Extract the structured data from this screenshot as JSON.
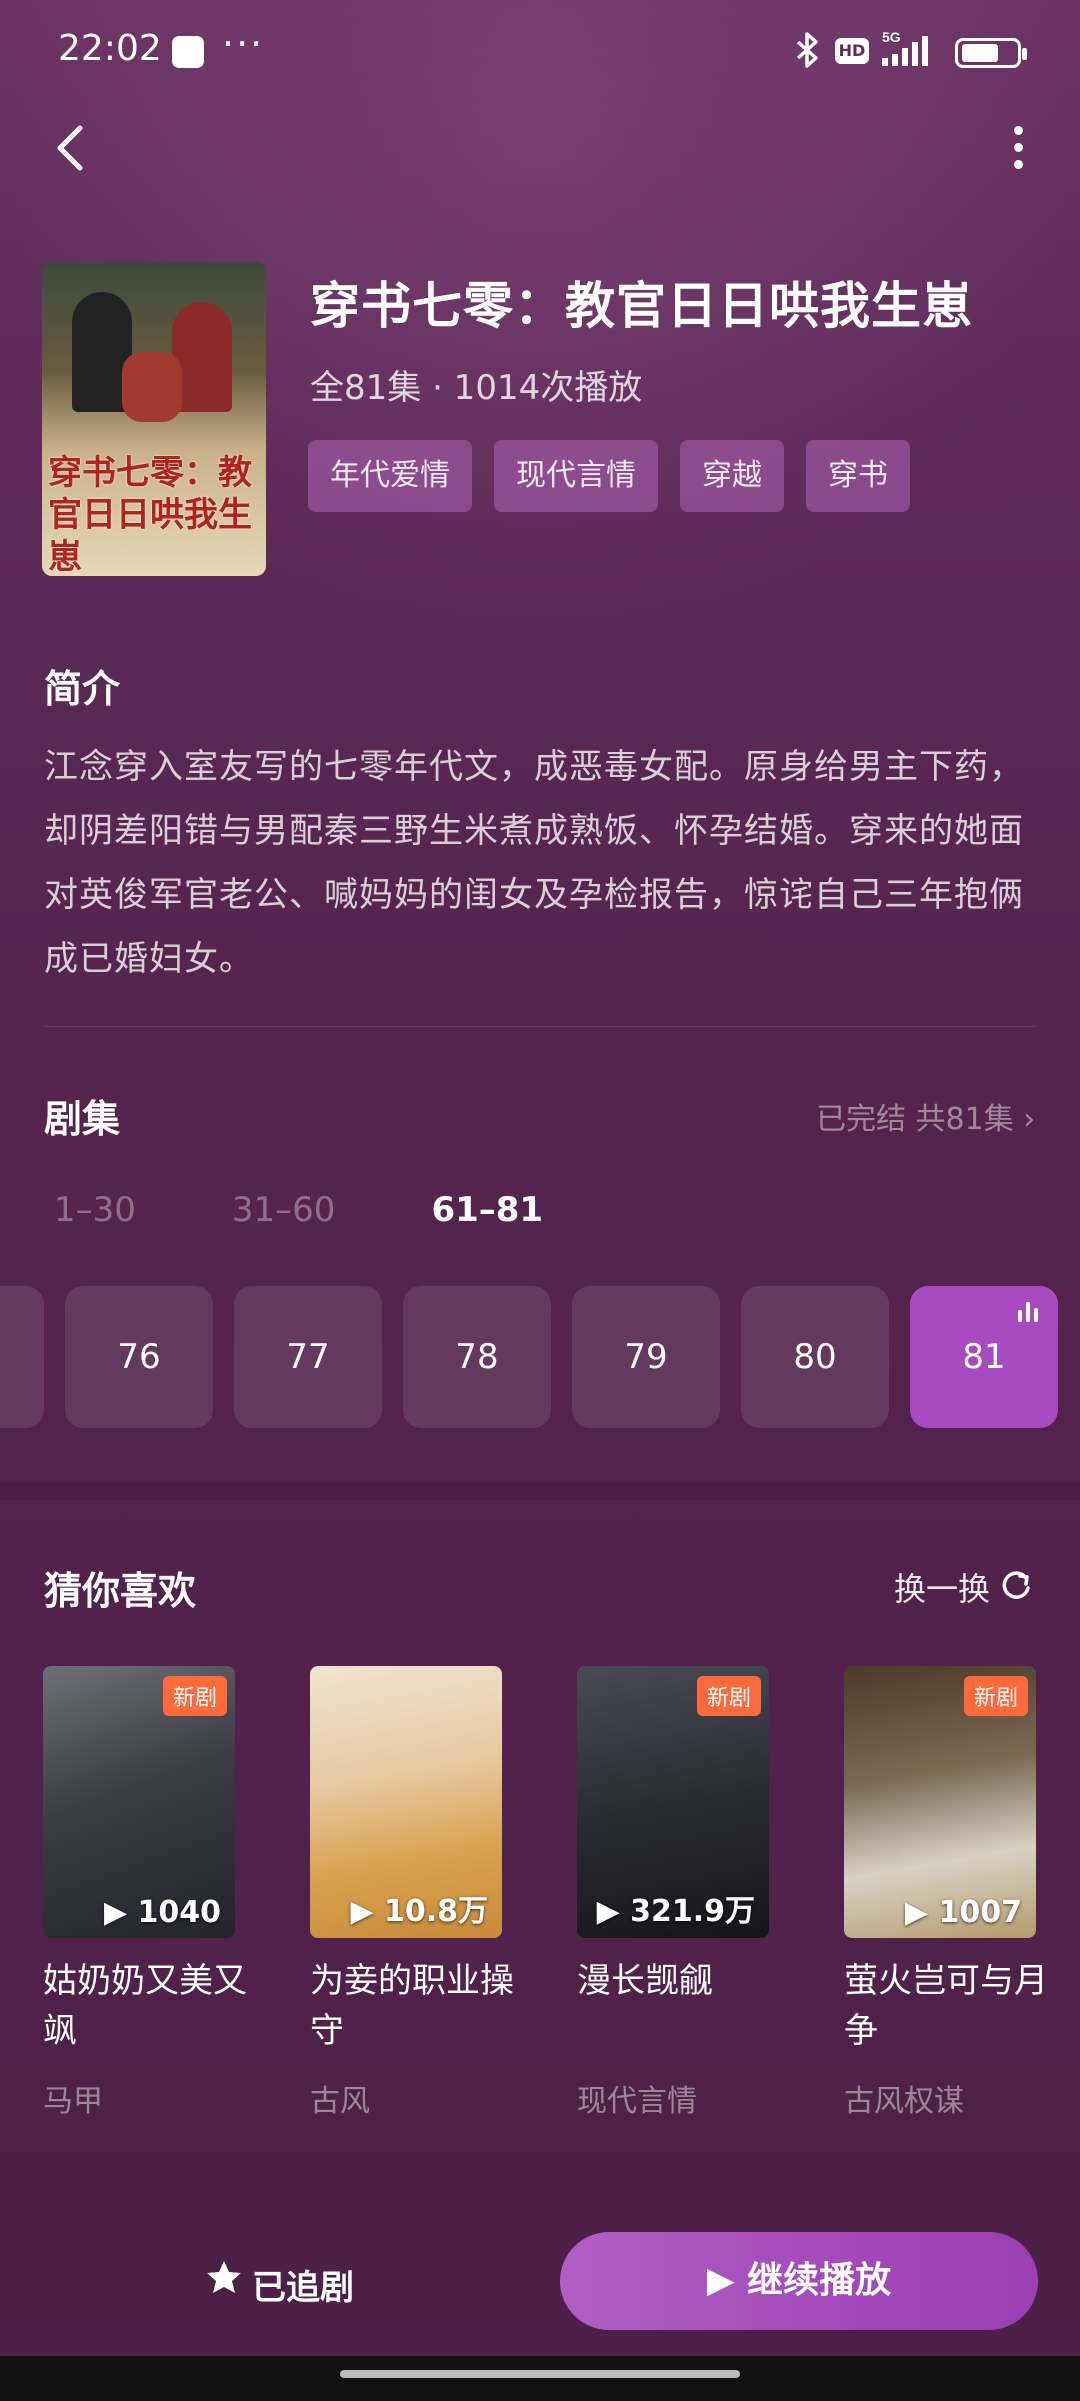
{
  "status": {
    "time": "22:02",
    "dots": "···",
    "hd": "HD",
    "net": "5G"
  },
  "header": {
    "title": "穿书七零：教官日日哄我生崽",
    "meta": "全81集 · 1014次播放",
    "cover_text": "穿书七零：教官日日哄我生崽",
    "tags": [
      "年代爱情",
      "现代言情",
      "穿越",
      "穿书"
    ]
  },
  "intro": {
    "title": "简介",
    "text": "江念穿入室友写的七零年代文，成恶毒女配。原身给男主下药，却阴差阳错与男配秦三野生米煮成熟饭、怀孕结婚。穿来的她面对英俊军官老公、喊妈妈的闺女及孕检报告，惊诧自己三年抱俩成已婚妇女。"
  },
  "episodes": {
    "title": "剧集",
    "status": "已完结 共81集",
    "ranges": [
      "1–30",
      "31–60",
      "61–81"
    ],
    "active_range": 2,
    "items": [
      "76",
      "77",
      "78",
      "79",
      "80",
      "81"
    ],
    "active_episode": "81"
  },
  "recommend": {
    "title": "猜你喜欢",
    "refresh": "换一换",
    "items": [
      {
        "name": "姑奶奶又美又飒",
        "genre": "马甲",
        "plays": "1040",
        "badge": "新剧"
      },
      {
        "name": "为妾的职业操守",
        "genre": "古风",
        "plays": "10.8万",
        "badge": ""
      },
      {
        "name": "漫长觊觎",
        "genre": "现代言情",
        "plays": "321.9万",
        "badge": "新剧"
      },
      {
        "name": "萤火岂可与月争",
        "genre": "古风权谋",
        "plays": "1007",
        "badge": "新剧"
      }
    ]
  },
  "actions": {
    "follow": "已追剧",
    "play": "继续播放"
  },
  "colors": {
    "accent": "#a64cc0",
    "badge": "#ff6a3d",
    "bg": "#57264f"
  }
}
